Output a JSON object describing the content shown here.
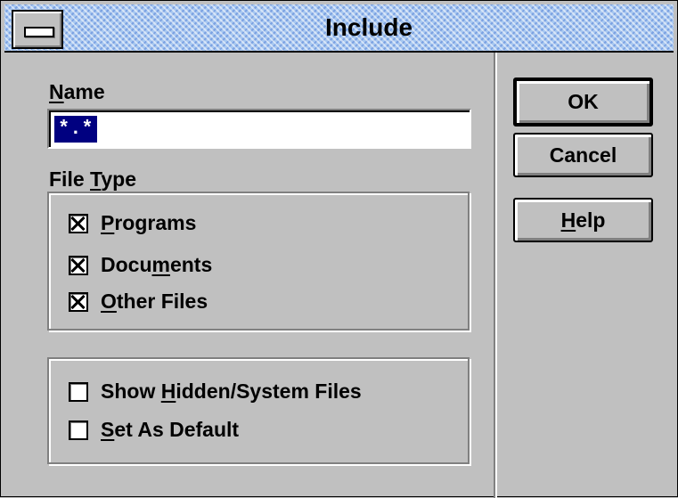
{
  "dialog": {
    "title": "Include"
  },
  "name_field": {
    "label_accel": "N",
    "label_rest": "ame",
    "value": "*.*"
  },
  "file_type": {
    "label_pre": "File ",
    "label_accel": "T",
    "label_post": "ype",
    "options": [
      {
        "pre": "",
        "accel": "P",
        "post": "rograms",
        "checked": true
      },
      {
        "pre": "Docu",
        "accel": "m",
        "post": "ents",
        "checked": true
      },
      {
        "pre": "",
        "accel": "O",
        "post": "ther Files",
        "checked": true
      }
    ]
  },
  "extra_options": [
    {
      "pre": "Show ",
      "accel": "H",
      "post": "idden/System Files",
      "checked": false
    },
    {
      "pre": "",
      "accel": "S",
      "post": "et As Default",
      "checked": false
    }
  ],
  "buttons": {
    "ok": "OK",
    "cancel": "Cancel",
    "help_accel": "H",
    "help_rest": "elp"
  }
}
